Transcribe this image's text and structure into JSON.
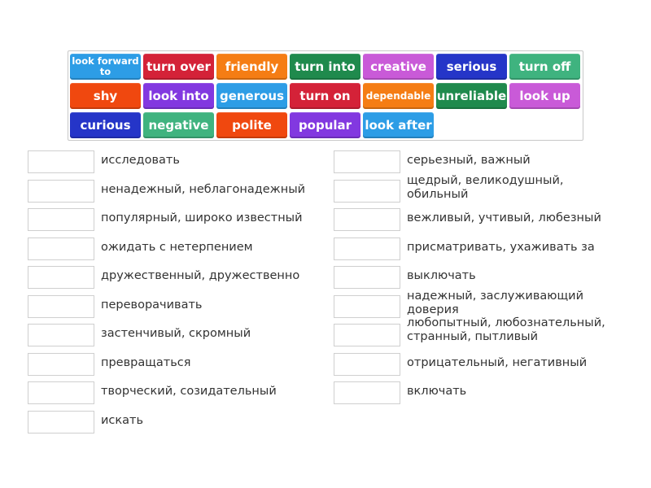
{
  "tiles": [
    {
      "label": "look forward to",
      "color": "#2d9de6"
    },
    {
      "label": "turn over",
      "color": "#d42238"
    },
    {
      "label": "friendly",
      "color": "#f57d14"
    },
    {
      "label": "turn into",
      "color": "#1f8a4d"
    },
    {
      "label": "creative",
      "color": "#c95ad8"
    },
    {
      "label": "serious",
      "color": "#2535c8"
    },
    {
      "label": "turn off",
      "color": "#3fb37f"
    },
    {
      "label": "shy",
      "color": "#f0480f"
    },
    {
      "label": "look into",
      "color": "#8238e0"
    },
    {
      "label": "generous",
      "color": "#2d9de6"
    },
    {
      "label": "turn on",
      "color": "#d42238"
    },
    {
      "label": "dependable",
      "color": "#f57d14"
    },
    {
      "label": "unreliable",
      "color": "#1f8a4d"
    },
    {
      "label": "look up",
      "color": "#c95ad8"
    },
    {
      "label": "curious",
      "color": "#2535c8"
    },
    {
      "label": "negative",
      "color": "#3fb37f"
    },
    {
      "label": "polite",
      "color": "#f0480f"
    },
    {
      "label": "popular",
      "color": "#8238e0"
    },
    {
      "label": "look after",
      "color": "#2d9de6"
    }
  ],
  "left_column": [
    {
      "text": "исследовать"
    },
    {
      "text": "ненадежный, неблагонадежный"
    },
    {
      "text": "популярный, широко известный"
    },
    {
      "text": "ожидать с нетерпением"
    },
    {
      "text": "дружественный, дружественно"
    },
    {
      "text": "переворачивать"
    },
    {
      "text": "застенчивый, скромный"
    },
    {
      "text": "превращаться"
    },
    {
      "text": "творческий, созидательный"
    },
    {
      "text": "искать"
    }
  ],
  "right_column": [
    {
      "text": "серьезный, важный"
    },
    {
      "text": "щедрый, великодушный, обильный"
    },
    {
      "text": "вежливый, учтивый, любезный"
    },
    {
      "text": "присматривать, ухаживать за"
    },
    {
      "text": "выключать"
    },
    {
      "text": "надежный, заслуживающий доверия"
    },
    {
      "text": "любопытный, любознательный, странный, пытливый"
    },
    {
      "text": "отрицательный, негативный"
    },
    {
      "text": "включать"
    }
  ]
}
